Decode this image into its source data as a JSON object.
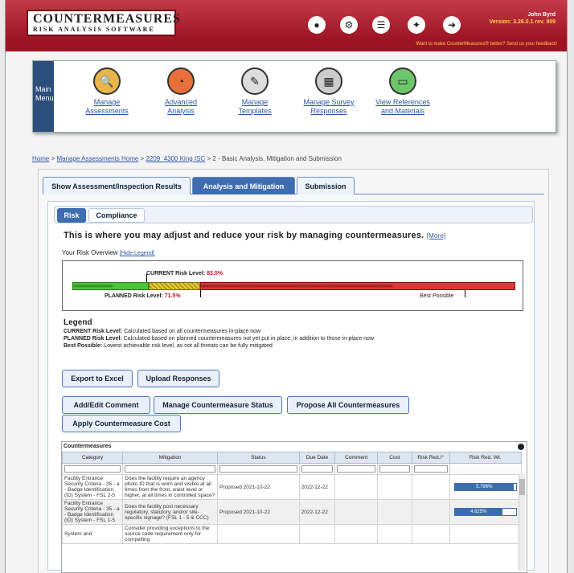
{
  "header": {
    "logo_line1": "COUNTERMEASURES",
    "logo_line2": "RISK ANALYSIS SOFTWARE",
    "user": "John Byrd",
    "version": "Version: 3.26.0.1 rev. 909",
    "feedback": "Want to make CounterMeasures® better? Send us your feedback!",
    "icons": [
      "bomb-icon",
      "gears-icon",
      "user-list-icon",
      "new-feature-icon",
      "logout-icon"
    ]
  },
  "menu": {
    "label": "Main Menu",
    "items": [
      {
        "label1": "Manage",
        "label2": "Assessments",
        "icon": "magnifier-icon"
      },
      {
        "label1": "Advanced",
        "label2": "Analysis",
        "icon": "chart-icon"
      },
      {
        "label1": "Manage",
        "label2": "Templates",
        "icon": "edit-icon"
      },
      {
        "label1": "Manage Survey",
        "label2": "Responses",
        "icon": "survey-icon"
      },
      {
        "label1": "View References",
        "label2": "and Materials",
        "icon": "book-icon"
      }
    ]
  },
  "breadcrumb": {
    "home": "Home",
    "assess_home": "Manage Assessments Home",
    "item": "2209_4300 King ISC",
    "current": "> 2 - Basic Analysis, Mitigation and Submission"
  },
  "tabs": [
    "Show Assessment/Inspection Results",
    "Analysis and Mitigation",
    "Submission"
  ],
  "subtabs": [
    "Risk",
    "Compliance"
  ],
  "intro": "This is where you may adjust and reduce your risk by managing countermeasures.",
  "intro_more": "[More]",
  "overview": "Your Risk Overview",
  "hide_legend": "[Hide Legend]",
  "risk": {
    "current_label": "CURRENT Risk Level:",
    "current_value": "83.5%",
    "planned_label": "PLANNED Risk Level:",
    "planned_value": "71.5%",
    "best_label": "Best Possible",
    "green_chevrons": "»»»»»»»»»»»»»»",
    "red_chevrons": "«««««««««««««««««««««««««««««««««««««««««««««««««««««««««««««««««««««"
  },
  "legend": {
    "title": "Legend",
    "current_b": "CURRENT Risk Level:",
    "current_t": " Calculated based on all countermeasures in-place now",
    "planned_b": "PLANNED Risk Level:",
    "planned_t": " Calculated based on planned countermeasures not yet put in place, in addition to those in-place now",
    "best_b": "Best Possible:",
    "best_t": " Lowest achievable risk level, as not all threats can be fully mitigated"
  },
  "buttons": {
    "export": "Export to Excel",
    "upload": "Upload Responses",
    "add_comment": "Add/Edit Comment",
    "manage_status": "Manage Countermeasure Status",
    "propose_all": "Propose All Countermeasures",
    "apply_cost": "Apply Countermeasure Cost"
  },
  "table": {
    "caption": "Countermeasures",
    "headers": [
      "Category",
      "Mitigation",
      "Status",
      "Due Date",
      "Comment",
      "Cost",
      "Risk Red./°",
      "Risk Red. Wt."
    ],
    "rows": [
      {
        "category": "Facility Entrance Security Criteria - 35 - a - Badge Identification (ID) System - FSL 2-5",
        "mitigation": "Does the facility require an agency photo ID that is worn and visible at all times from the front, waist level or higher, at all times in controlled space?",
        "status": "Proposed 2021-10-22",
        "due": "2022-12-22",
        "comment": "",
        "cost": "",
        "rr": "",
        "rrw": "5.796%",
        "rrw_fraction": 0.96
      },
      {
        "category": "Facility Entrance Security Criteria - 35 - a - Badge Identification (ID) System - FSL 1-5",
        "mitigation": "Does the facility post necessary regulatory, statutory, and/or site-specific signage? (FSL 1 - 5 & CCC)",
        "status": "Proposed 2021-10-22",
        "due": "2022-12-22",
        "comment": "",
        "cost": "",
        "rr": "",
        "rrw": "4.625%",
        "rrw_fraction": 0.77
      },
      {
        "category": "System and",
        "mitigation": "Consider providing exceptions to the source code requirement only for compelling",
        "status": "",
        "due": "",
        "comment": "",
        "cost": "",
        "rr": "",
        "rrw": "",
        "rrw_fraction": 0
      }
    ]
  }
}
